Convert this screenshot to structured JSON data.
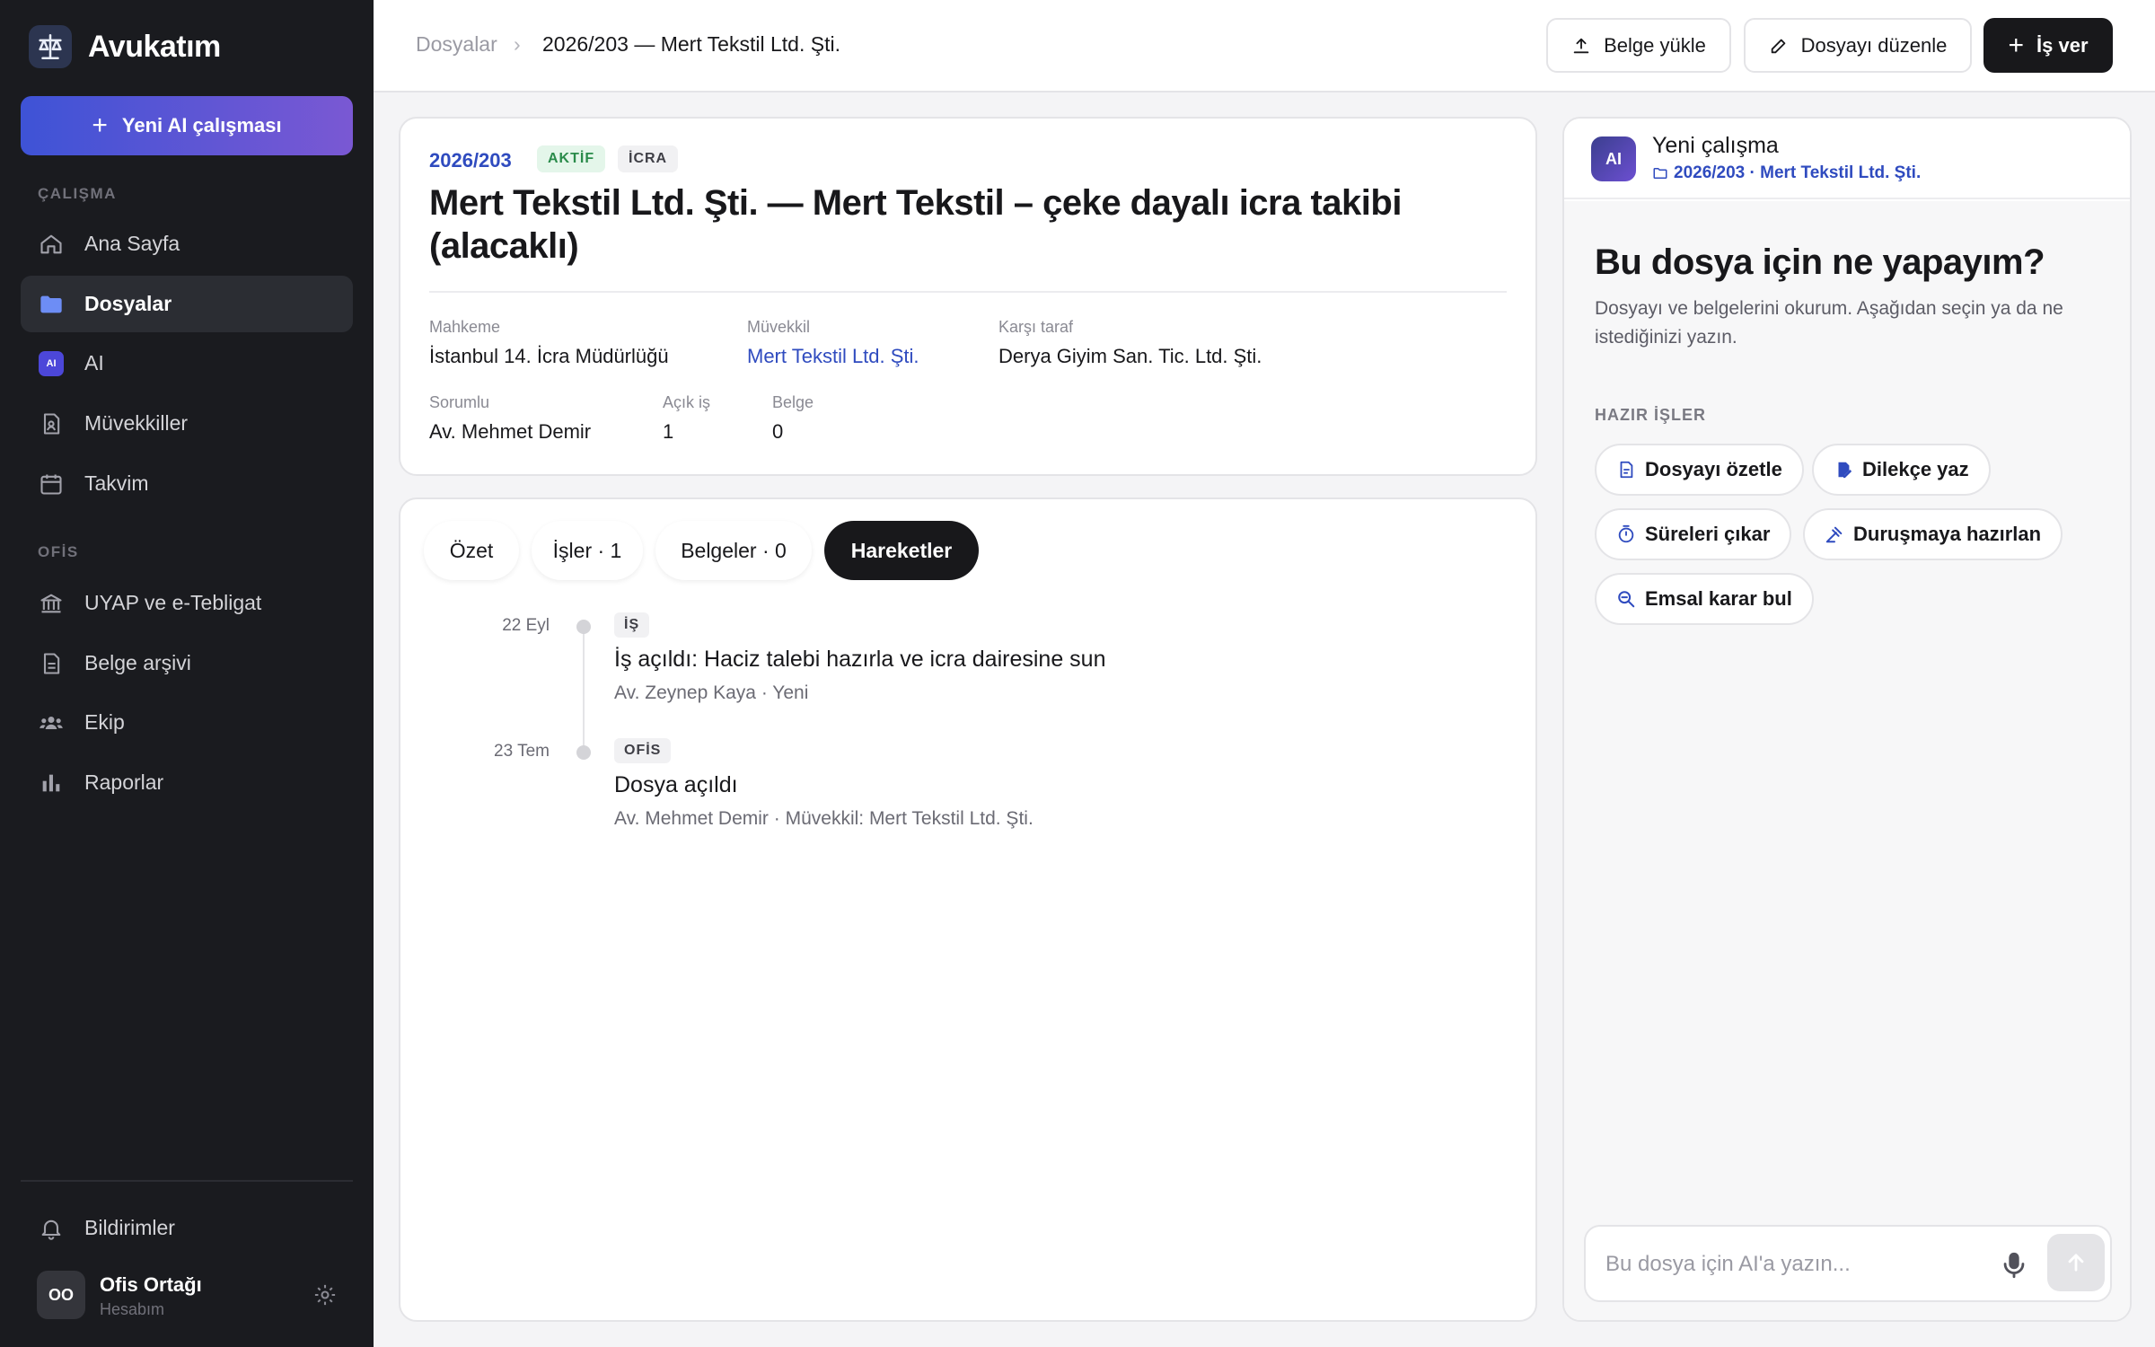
{
  "app": {
    "name": "Avukatım"
  },
  "sidebar": {
    "new_ai_label": "Yeni AI çalışması",
    "section_work": "ÇALIŞMA",
    "section_office": "OFİS",
    "items": [
      {
        "label": "Ana Sayfa",
        "icon": "home-icon"
      },
      {
        "label": "Dosyalar",
        "icon": "folder-icon",
        "active": true
      },
      {
        "label": "AI",
        "icon": "ai-icon",
        "chip": "AI"
      },
      {
        "label": "Müvekkiller",
        "icon": "client-icon"
      },
      {
        "label": "Takvim",
        "icon": "calendar-icon"
      },
      {
        "label": "UYAP ve e-Tebligat",
        "icon": "court-icon"
      },
      {
        "label": "Belge arşivi",
        "icon": "document-icon"
      },
      {
        "label": "Ekip",
        "icon": "team-icon"
      },
      {
        "label": "Raporlar",
        "icon": "chart-icon"
      }
    ],
    "notifications_label": "Bildirimler",
    "user": {
      "initials": "OO",
      "name": "Ofis Ortağı",
      "sub": "Hesabım"
    }
  },
  "topbar": {
    "breadcrumb_root": "Dosyalar",
    "breadcrumb_sep": "›",
    "breadcrumb_current": "2026/203 — Mert Tekstil Ltd. Şti.",
    "upload_label": "Belge yükle",
    "edit_label": "Dosyayı düzenle",
    "assign_label": "İş ver"
  },
  "case": {
    "number": "2026/203",
    "status": "AKTİF",
    "type": "İCRA",
    "title": "Mert Tekstil Ltd. Şti. — Mert Tekstil – çeke dayalı icra takibi (alacaklı)",
    "fields": {
      "court_label": "Mahkeme",
      "court": "İstanbul 14. İcra Müdürlüğü",
      "client_label": "Müvekkil",
      "client": "Mert Tekstil Ltd. Şti.",
      "opponent_label": "Karşı taraf",
      "opponent": "Derya Giyim San. Tic. Ltd. Şti.",
      "responsible_label": "Sorumlu",
      "responsible": "Av. Mehmet Demir",
      "open_tasks_label": "Açık iş",
      "open_tasks": "1",
      "documents_label": "Belge",
      "documents": "0"
    }
  },
  "tabs": [
    {
      "label": "Özet"
    },
    {
      "label": "İşler · 1"
    },
    {
      "label": "Belgeler · 0"
    },
    {
      "label": "Hareketler",
      "active": true
    }
  ],
  "timeline": [
    {
      "date": "22 Eyl",
      "tag": "İŞ",
      "title": "İş açıldı: Haciz talebi hazırla ve icra dairesine sun",
      "sub": "Av. Zeynep Kaya · Yeni"
    },
    {
      "date": "23 Tem",
      "tag": "OFİS",
      "title": "Dosya açıldı",
      "sub": "Av. Mehmet Demir · Müvekkil: Mert Tekstil Ltd. Şti."
    }
  ],
  "ai_panel": {
    "avatar": "AI",
    "title": "Yeni çalışma",
    "context": "2026/203 · Mert Tekstil Ltd. Şti.",
    "heading": "Bu dosya için ne yapayım?",
    "description": "Dosyayı ve belgelerini okurum. Aşağıdan seçin ya da ne istediğinizi yazın.",
    "ready_label": "HAZIR İŞLER",
    "actions": [
      {
        "label": "Dosyayı özetle",
        "icon": "summary-icon"
      },
      {
        "label": "Dilekçe yaz",
        "icon": "petition-icon"
      },
      {
        "label": "Süreleri çıkar",
        "icon": "timer-icon"
      },
      {
        "label": "Duruşmaya hazırlan",
        "icon": "gavel-icon"
      },
      {
        "label": "Emsal karar bul",
        "icon": "search-precedent-icon"
      }
    ],
    "input_placeholder": "Bu dosya için AI'a yazın..."
  }
}
